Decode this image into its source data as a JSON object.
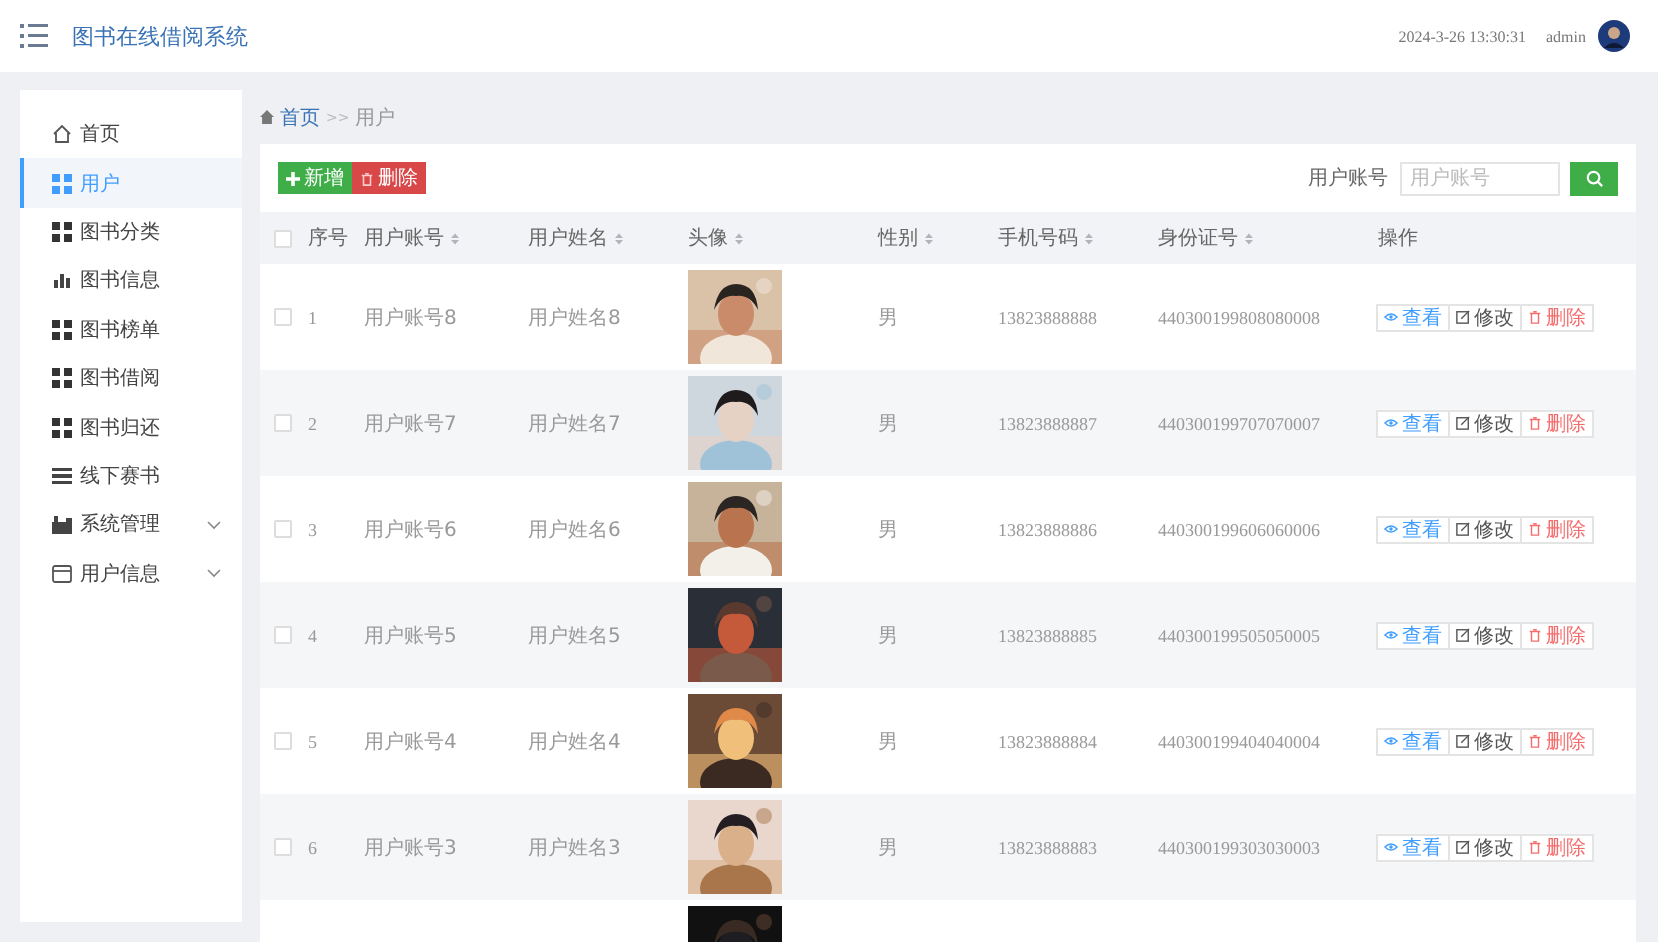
{
  "header": {
    "title": "图书在线借阅系统",
    "datetime": "2024-3-26 13:30:31",
    "user": "admin"
  },
  "sidebar": {
    "items": [
      {
        "label": "首页",
        "selected": false
      },
      {
        "label": "用户",
        "selected": true
      },
      {
        "label": "图书分类",
        "selected": false
      },
      {
        "label": "图书信息",
        "selected": false
      },
      {
        "label": "图书榜单",
        "selected": false
      },
      {
        "label": "图书借阅",
        "selected": false
      },
      {
        "label": "图书归还",
        "selected": false
      },
      {
        "label": "线下赛书",
        "selected": false
      },
      {
        "label": "系统管理",
        "selected": false,
        "expanded": false
      },
      {
        "label": "用户信息",
        "selected": false,
        "expanded": false
      }
    ]
  },
  "breadcrumb": {
    "home": "首页",
    "separator": ">>",
    "current": "用户"
  },
  "toolbar": {
    "buttons": [
      {
        "kind": "add",
        "label": "新增"
      },
      {
        "kind": "delete",
        "label": "删除"
      }
    ],
    "search": {
      "label": "用户账号",
      "placeholder": "用户账号"
    }
  },
  "table": {
    "select_all_checked": false,
    "columns": [
      {
        "label": "序号",
        "sortable": false
      },
      {
        "label": "用户账号",
        "sortable": true
      },
      {
        "label": "用户姓名",
        "sortable": true
      },
      {
        "label": "头像",
        "sortable": true
      },
      {
        "label": "性别",
        "sortable": true
      },
      {
        "label": "手机号码",
        "sortable": true
      },
      {
        "label": "身份证号",
        "sortable": true
      },
      {
        "label": "操作",
        "sortable": false
      }
    ],
    "rows": [
      {
        "checked": false,
        "index": "1",
        "account": "用户账号8",
        "name": "用户姓名8",
        "avatar": {
          "kind": "picture"
        },
        "gender": "男",
        "phone": "13823888888",
        "id_number": "440300199808080008",
        "actions": [
          {
            "kind": "view",
            "label": "查看"
          },
          {
            "kind": "edit",
            "label": "修改"
          },
          {
            "kind": "delete",
            "label": "删除"
          }
        ]
      },
      {
        "checked": false,
        "index": "2",
        "account": "用户账号7",
        "name": "用户姓名7",
        "avatar": {
          "kind": "picture"
        },
        "gender": "男",
        "phone": "13823888887",
        "id_number": "440300199707070007",
        "actions": [
          {
            "kind": "view",
            "label": "查看"
          },
          {
            "kind": "edit",
            "label": "修改"
          },
          {
            "kind": "delete",
            "label": "删除"
          }
        ]
      },
      {
        "checked": false,
        "index": "3",
        "account": "用户账号6",
        "name": "用户姓名6",
        "avatar": {
          "kind": "picture"
        },
        "gender": "男",
        "phone": "13823888886",
        "id_number": "440300199606060006",
        "actions": [
          {
            "kind": "view",
            "label": "查看"
          },
          {
            "kind": "edit",
            "label": "修改"
          },
          {
            "kind": "delete",
            "label": "删除"
          }
        ]
      },
      {
        "checked": false,
        "index": "4",
        "account": "用户账号5",
        "name": "用户姓名5",
        "avatar": {
          "kind": "picture"
        },
        "gender": "男",
        "phone": "13823888885",
        "id_number": "440300199505050005",
        "actions": [
          {
            "kind": "view",
            "label": "查看"
          },
          {
            "kind": "edit",
            "label": "修改"
          },
          {
            "kind": "delete",
            "label": "删除"
          }
        ]
      },
      {
        "checked": false,
        "index": "5",
        "account": "用户账号4",
        "name": "用户姓名4",
        "avatar": {
          "kind": "picture"
        },
        "gender": "男",
        "phone": "13823888884",
        "id_number": "440300199404040004",
        "actions": [
          {
            "kind": "view",
            "label": "查看"
          },
          {
            "kind": "edit",
            "label": "修改"
          },
          {
            "kind": "delete",
            "label": "删除"
          }
        ]
      },
      {
        "checked": false,
        "index": "6",
        "account": "用户账号3",
        "name": "用户姓名3",
        "avatar": {
          "kind": "picture"
        },
        "gender": "男",
        "phone": "13823888883",
        "id_number": "440300199303030003",
        "actions": [
          {
            "kind": "view",
            "label": "查看"
          },
          {
            "kind": "edit",
            "label": "修改"
          },
          {
            "kind": "delete",
            "label": "删除"
          }
        ]
      },
      {
        "avatar": {
          "kind": "picture"
        }
      }
    ]
  }
}
